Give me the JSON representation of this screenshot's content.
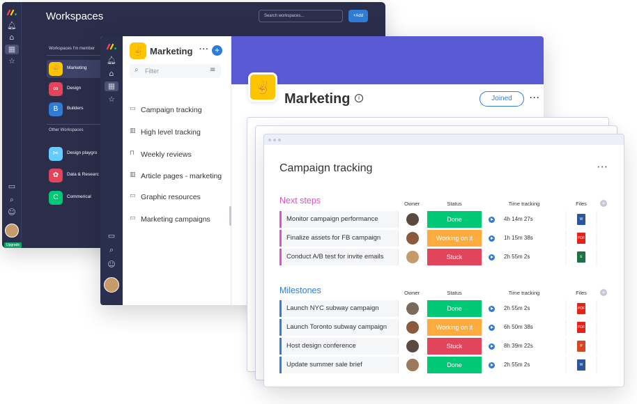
{
  "back": {
    "title": "Workspaces",
    "search_placeholder": "Search workspaces...",
    "add_label": "+Add",
    "section_member": "Workspaces I'm member",
    "section_other": "Other Workspaces",
    "upgrade": "Upgrade",
    "member_workspaces": [
      {
        "badge": "✌",
        "label": "Marketing",
        "color": "#fdc400"
      },
      {
        "badge": "∞",
        "label": "Design",
        "color": "#e2445c"
      },
      {
        "badge": "B",
        "label": "Builders",
        "color": "#2e7cd6"
      }
    ],
    "other_workspaces": [
      {
        "badge": "✂",
        "label": "Design playgro",
        "color": "#66ccff"
      },
      {
        "badge": "✿",
        "label": "Data & Researc",
        "color": "#e2445c"
      },
      {
        "badge": "C",
        "label": "Commerical",
        "color": "#00c875"
      }
    ]
  },
  "panel": {
    "logo": "✌",
    "title": "Marketing",
    "filter_placeholder": "Filter",
    "boards": [
      {
        "icon": "▭",
        "label": "Campaign tracking"
      },
      {
        "icon": "▥",
        "label": "High level tracking"
      },
      {
        "icon": "⊓",
        "label": "Weekly reviews"
      },
      {
        "icon": "▥",
        "label": "Article pages - marketing"
      },
      {
        "icon": "▭",
        "label": "Graphic resources"
      },
      {
        "icon": "▭",
        "label": "Marketing campaigns"
      }
    ]
  },
  "workspace_header": {
    "logo": "✌",
    "title": "Marketing",
    "info": "i",
    "joined_label": "Joined",
    "more": "···"
  },
  "board": {
    "title": "Campaign tracking",
    "more": "···",
    "columns": {
      "owner": "Owner",
      "status": "Status",
      "time": "Time tracking",
      "files": "Files"
    },
    "groups": [
      {
        "title": "Next steps",
        "color": "#e04fc8",
        "bar_color": "#e04fc8",
        "rows": [
          {
            "name": "Monitor campaign performance",
            "status": "Done",
            "status_color": "#00c875",
            "time": "4h 14m 27s",
            "file": "W",
            "file_color": "#2b579a",
            "avatar_color": "#5a4a42"
          },
          {
            "name": "Finalize assets for FB campaign",
            "status": "Working on it",
            "status_color": "#fdab3d",
            "time": "1h 15m 38s",
            "file": "PDF",
            "file_color": "#e2231a",
            "avatar_color": "#8a5a3c"
          },
          {
            "name": "Conduct A/B test for invite emails",
            "status": "Stuck",
            "status_color": "#e2445c",
            "time": "2h 55m 2s",
            "file": "E",
            "file_color": "#1d7044",
            "avatar_color": "#c79a6a"
          }
        ]
      },
      {
        "title": "Milestones",
        "color": "#2e7cd6",
        "bar_color": "#2e7cd6",
        "rows": [
          {
            "name": "Launch NYC subway campaign",
            "status": "Done",
            "status_color": "#00c875",
            "time": "2h 55m 2s",
            "file": "PDF",
            "file_color": "#e2231a",
            "avatar_color": "#7a6a5a"
          },
          {
            "name": "Launch Toronto subway campaign",
            "status": "Working on it",
            "status_color": "#fdab3d",
            "time": "6h 50m 38s",
            "file": "PDF",
            "file_color": "#e2231a",
            "avatar_color": "#8a5a3c"
          },
          {
            "name": "Host design conference",
            "status": "Stuck",
            "status_color": "#e2445c",
            "time": "8h 39m 22s",
            "file": "P",
            "file_color": "#d24726",
            "avatar_color": "#5a4a42"
          },
          {
            "name": "Update summer sale brief",
            "status": "Done",
            "status_color": "#00c875",
            "time": "2h 55m 2s",
            "file": "W",
            "file_color": "#2b579a",
            "avatar_color": "#9a7a5a"
          }
        ]
      }
    ]
  }
}
